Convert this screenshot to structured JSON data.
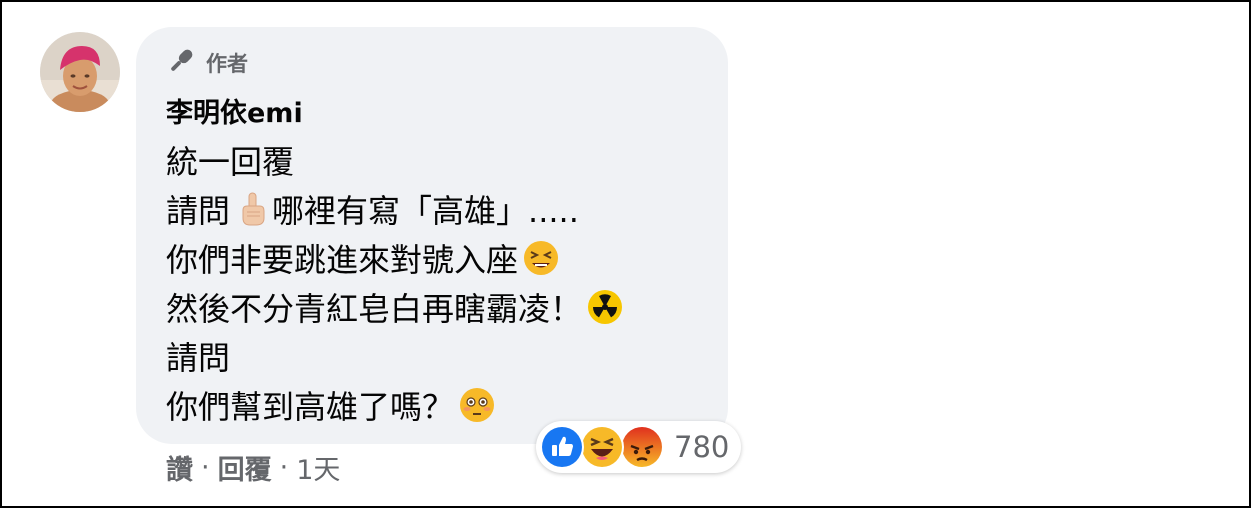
{
  "comment": {
    "author_badge": "作者",
    "author_name": "李明依emi",
    "lines": [
      {
        "text": "統一回覆",
        "emoji": ""
      },
      {
        "text": "請問",
        "emoji": "pointing-up-emoji",
        "text_after": "哪裡有寫「高雄」....."
      },
      {
        "text": "你們非要跳進來對號入座",
        "emoji": "tired-face-emoji"
      },
      {
        "text": "然後不分青紅皂白再瞎霸凌！",
        "emoji": "radioactive-emoji"
      },
      {
        "text": "請問",
        "emoji": ""
      },
      {
        "text": "你們幫到高雄了嗎？",
        "emoji": "flushed-face-emoji"
      }
    ]
  },
  "reactions": {
    "icons": [
      "like-reaction-icon",
      "haha-reaction-icon",
      "angry-reaction-icon"
    ],
    "count": "780"
  },
  "actions": {
    "like": "讚",
    "separator": "·",
    "reply": "回覆",
    "time": "1天"
  },
  "colors": {
    "bubble": "#f0f2f5",
    "secondary_text": "#65676b",
    "primary_text": "#050505",
    "like_blue": "#1877f2",
    "haha_yellow": "#f7b928",
    "angry_orange": "#e9710f"
  }
}
